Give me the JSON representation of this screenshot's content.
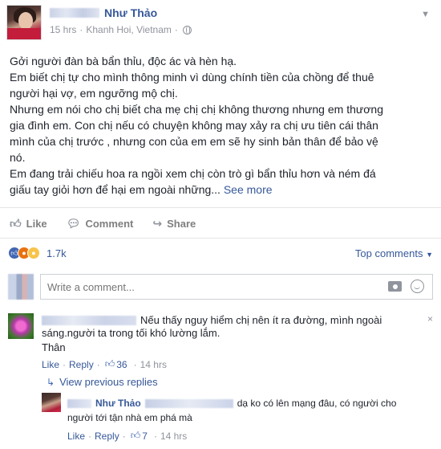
{
  "post": {
    "author": "Như Thảo",
    "time": "15 hrs",
    "location": "Khanh Hoi, Vietnam",
    "icons": {
      "privacy": "globe-icon",
      "menu": "chevron-down-icon"
    },
    "lines": [
      "Gởi người đàn bà bẩn thỉu, độc ác và hèn hạ.",
      "Em biết chị tự cho mình thông minh vì dùng chính tiền của chồng để thuê",
      "người hại vợ, em ngưỡng mộ chị.",
      "Nhưng em nói cho chị biết cha mẹ chị chị không thương nhưng em thương",
      "gia đình em. Con chị nếu có chuyện không may xảy ra chị ưu tiên cái thân",
      "mình của chị trước , nhưng con của em em sẽ hy sinh bản thân để bảo vệ",
      "nó.",
      "Em đang trải chiếu hoa ra ngồi xem chị còn trò gì bẩn thỉu hơn và ném đá"
    ],
    "last_line": "giấu tay giỏi hơn để hại em ngoài những...",
    "see_more": "See more"
  },
  "actions": {
    "like": "Like",
    "comment": "Comment",
    "share": "Share"
  },
  "reactions": {
    "count": "1.7k",
    "types": [
      "like",
      "angry",
      "sad"
    ],
    "top_comments": "Top comments"
  },
  "write_comment": {
    "placeholder": "Write a comment...",
    "camera_icon": "camera-icon",
    "emoji_icon": "smiley-icon"
  },
  "comments": [
    {
      "line1": "Nếu thấy nguy hiểm chị nên ít ra đường, mình ngoài",
      "line2": "sáng.người ta trong tối khó lường lắm.",
      "line3": "Thân",
      "like": "Like",
      "reply": "Reply",
      "likes": "36",
      "time": "14 hrs",
      "close": "×"
    }
  ],
  "view_previous": "View previous replies",
  "reply": {
    "author": "Như Thảo",
    "line1": "dạ ko có lên mạng đâu, có người cho",
    "line2": "người tới tận nhà em phá mà",
    "like": "Like",
    "reply": "Reply",
    "likes": "7",
    "time": "14 hrs"
  },
  "colors": {
    "link": "#365899",
    "meta": "#90949c",
    "text": "#1d2129",
    "like_blue": "#4267b2"
  }
}
